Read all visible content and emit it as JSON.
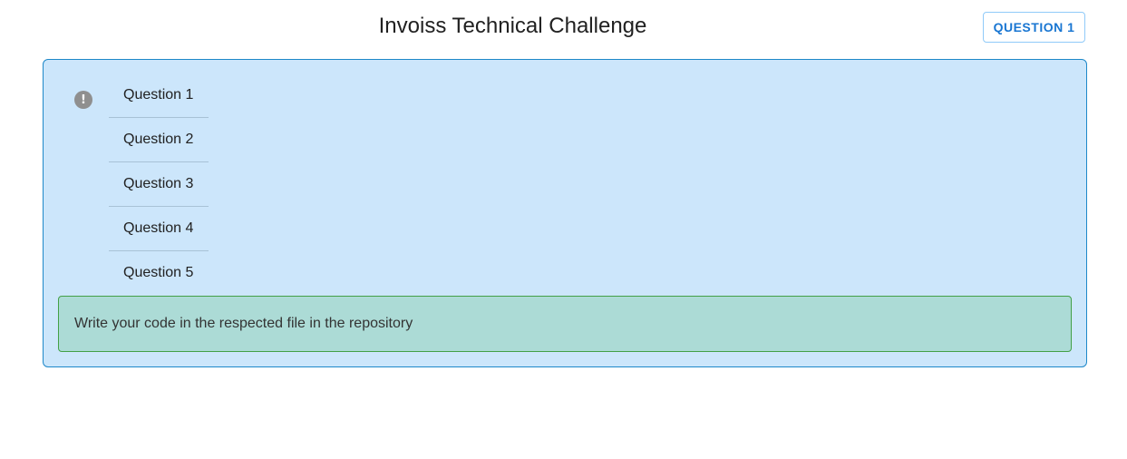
{
  "header": {
    "title": "Invoiss Technical Challenge",
    "button_label": "QUESTION 1"
  },
  "panel": {
    "icon": "exclamation-icon",
    "questions": [
      {
        "label": "Question 1"
      },
      {
        "label": "Question 2"
      },
      {
        "label": "Question 3"
      },
      {
        "label": "Question 4"
      },
      {
        "label": "Question 5"
      }
    ],
    "info_text": "Write your code in the respected file in the repository"
  },
  "colors": {
    "panel_background": "#cce6fb",
    "panel_border": "#1e88c9",
    "info_background": "#acdbd6",
    "info_border": "#43a047",
    "button_text": "#1976d2"
  }
}
